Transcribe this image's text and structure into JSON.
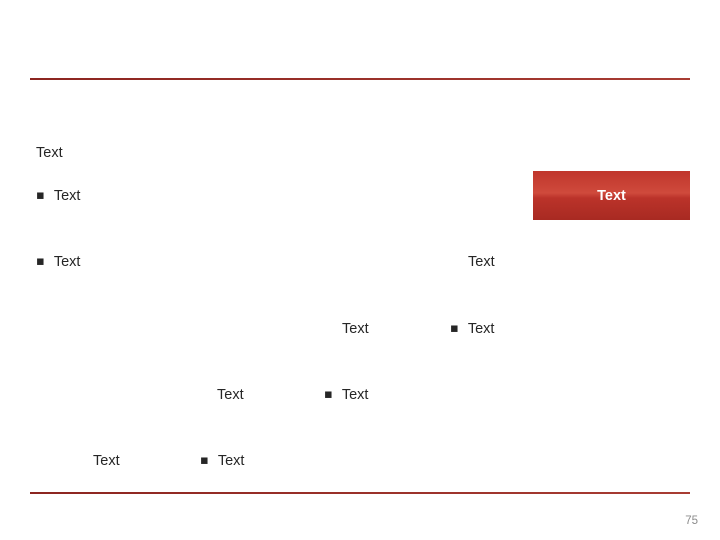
{
  "slide": {
    "page_number": "75",
    "accent_color": "#a83c33",
    "text_color": "#262626",
    "bullet_glyph": "▪",
    "rules": [
      {
        "name": "top-divider"
      },
      {
        "name": "bottom-divider"
      }
    ],
    "red_box": {
      "label": "Text"
    },
    "items": [
      {
        "label": "Text"
      },
      {
        "label": "Text"
      },
      {
        "label": "Text"
      },
      {
        "label": "Text"
      },
      {
        "label": "Text"
      },
      {
        "label": "Text"
      },
      {
        "label": "Text"
      },
      {
        "label": "Text"
      },
      {
        "label": "Text"
      },
      {
        "label": "Text"
      },
      {
        "label": "Text"
      }
    ]
  }
}
